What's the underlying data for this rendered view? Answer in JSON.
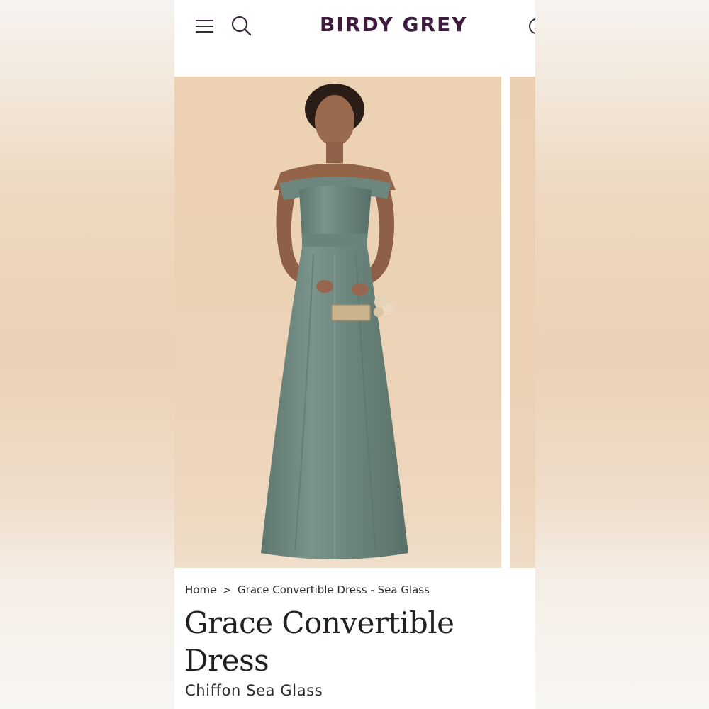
{
  "header": {
    "brand": "BIRDY GREY",
    "brand_color": "#3e1a3f",
    "icons": [
      "menu-icon",
      "search-icon",
      "account-icon"
    ]
  },
  "gallery": {
    "image_description_icon": "product-photo",
    "dress_color": "#6f8a82"
  },
  "breadcrumb": {
    "home": "Home",
    "separator": ">",
    "current": "Grace Convertible Dress - Sea Glass"
  },
  "product": {
    "title": "Grace Convertible Dress",
    "subtitle": "Chiffon Sea Glass"
  }
}
